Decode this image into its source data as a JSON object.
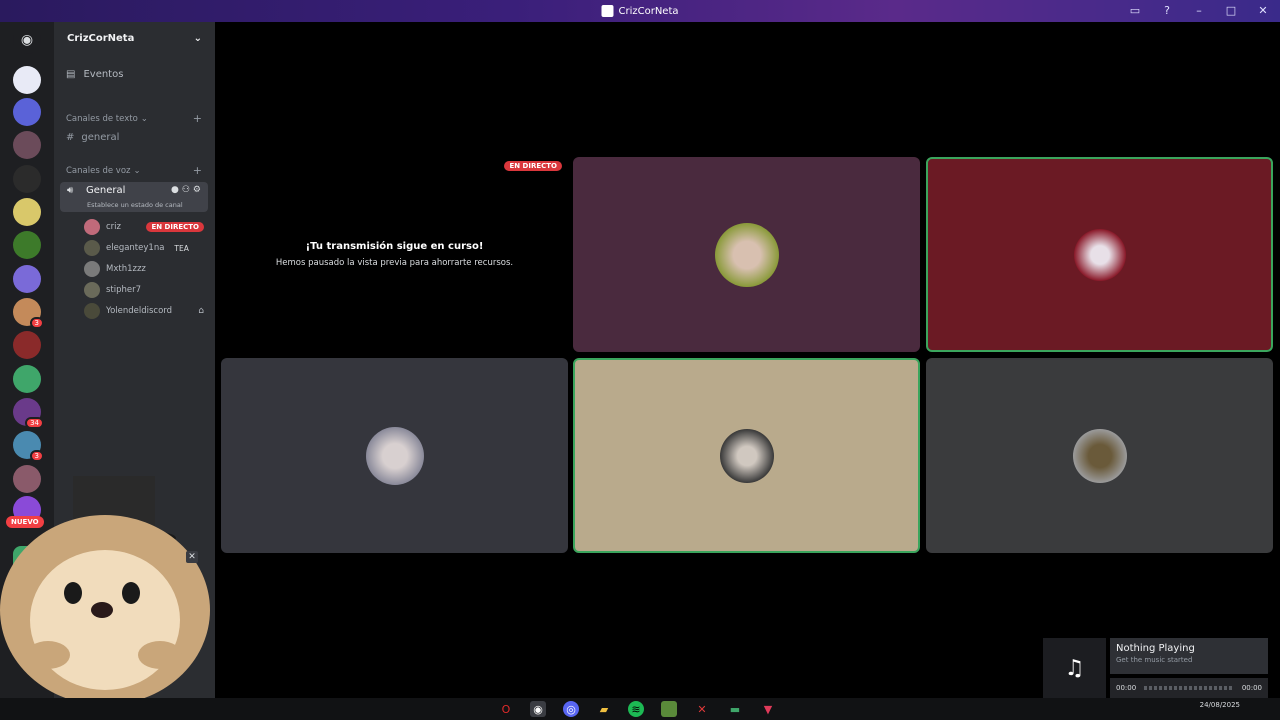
{
  "window": {
    "title": "CrizCorNeta"
  },
  "server": {
    "name": "CrizCorNeta",
    "events_label": "Eventos",
    "text_category": "Canales de texto",
    "text_channels": [
      "general"
    ],
    "voice_category": "Canales de voz",
    "voice_channel": {
      "name": "General",
      "status": "Establece un estado de canal"
    }
  },
  "voice_users": [
    {
      "name": "criz",
      "badge": "EN DIRECTO"
    },
    {
      "name": "elegantey1na",
      "extra": "TEA"
    },
    {
      "name": "Mxth1zzz"
    },
    {
      "name": "stipher7"
    },
    {
      "name": "Yolendeldiscord"
    }
  ],
  "rail": {
    "new_label": "NUEVO",
    "badges": [
      "3",
      "34",
      "3"
    ]
  },
  "stream": {
    "live_label": "EN DIRECTO",
    "title": "¡Tu transmisión sigue en curso!",
    "subtitle": "Hemos pausado la vista previa para ahorrarte recursos."
  },
  "music": {
    "track": "Nothing Playing",
    "subtitle": "Get the music started",
    "time_start": "00:00",
    "time_end": "00:00"
  },
  "taskbar": {
    "date": "24/08/2025"
  },
  "colors": {
    "speaking": "#3ba55d",
    "tile_purple": "#4a2a3e",
    "tile_red": "#6b1a24",
    "tile_gray": "#35363d",
    "tile_tan": "#b9aa8c",
    "tile_darkgray": "#3a3b3d"
  }
}
